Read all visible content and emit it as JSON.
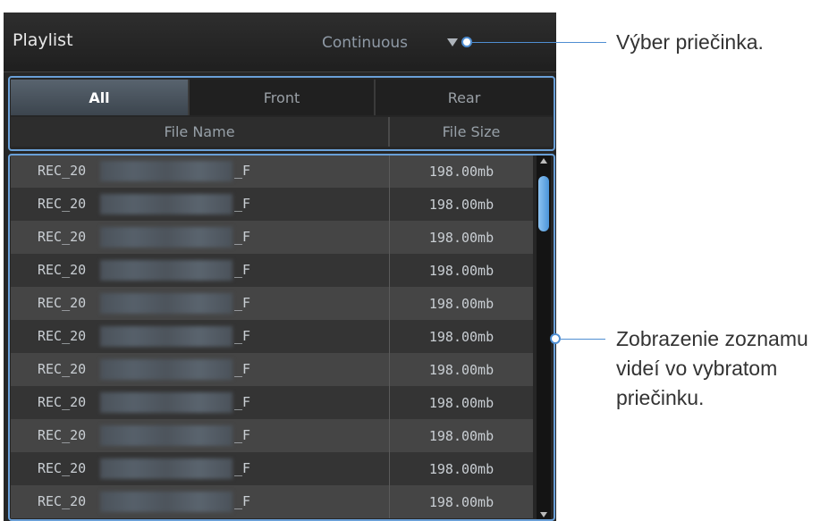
{
  "header": {
    "title": "Playlist",
    "mode": "Continuous"
  },
  "tabs": [
    {
      "label": "All",
      "active": true
    },
    {
      "label": "Front",
      "active": false
    },
    {
      "label": "Rear",
      "active": false
    }
  ],
  "columns": {
    "name": "File Name",
    "size": "File Size"
  },
  "files": [
    {
      "prefix": "REC_20",
      "suffix": "_F",
      "size": "198.00mb"
    },
    {
      "prefix": "REC_20",
      "suffix": "_F",
      "size": "198.00mb"
    },
    {
      "prefix": "REC_20",
      "suffix": "_F",
      "size": "198.00mb"
    },
    {
      "prefix": "REC_20",
      "suffix": "_F",
      "size": "198.00mb"
    },
    {
      "prefix": "REC_20",
      "suffix": "_F",
      "size": "198.00mb"
    },
    {
      "prefix": "REC_20",
      "suffix": "_F",
      "size": "198.00mb"
    },
    {
      "prefix": "REC_20",
      "suffix": "_F",
      "size": "198.00mb"
    },
    {
      "prefix": "REC_20",
      "suffix": "_F",
      "size": "198.00mb"
    },
    {
      "prefix": "REC_20",
      "suffix": "_F",
      "size": "198.00mb"
    },
    {
      "prefix": "REC_20",
      "suffix": "_F",
      "size": "198.00mb"
    },
    {
      "prefix": "REC_20",
      "suffix": "_F",
      "size": "198.00mb"
    }
  ],
  "callouts": {
    "folder": "Výber priečinka.",
    "list_line1": "Zobrazenie zoznamu",
    "list_line2": "videí vo vybratom",
    "list_line3": "priečinku."
  },
  "colors": {
    "accent": "#4f8ed2",
    "scroll_thumb": "#5aa3e6"
  }
}
